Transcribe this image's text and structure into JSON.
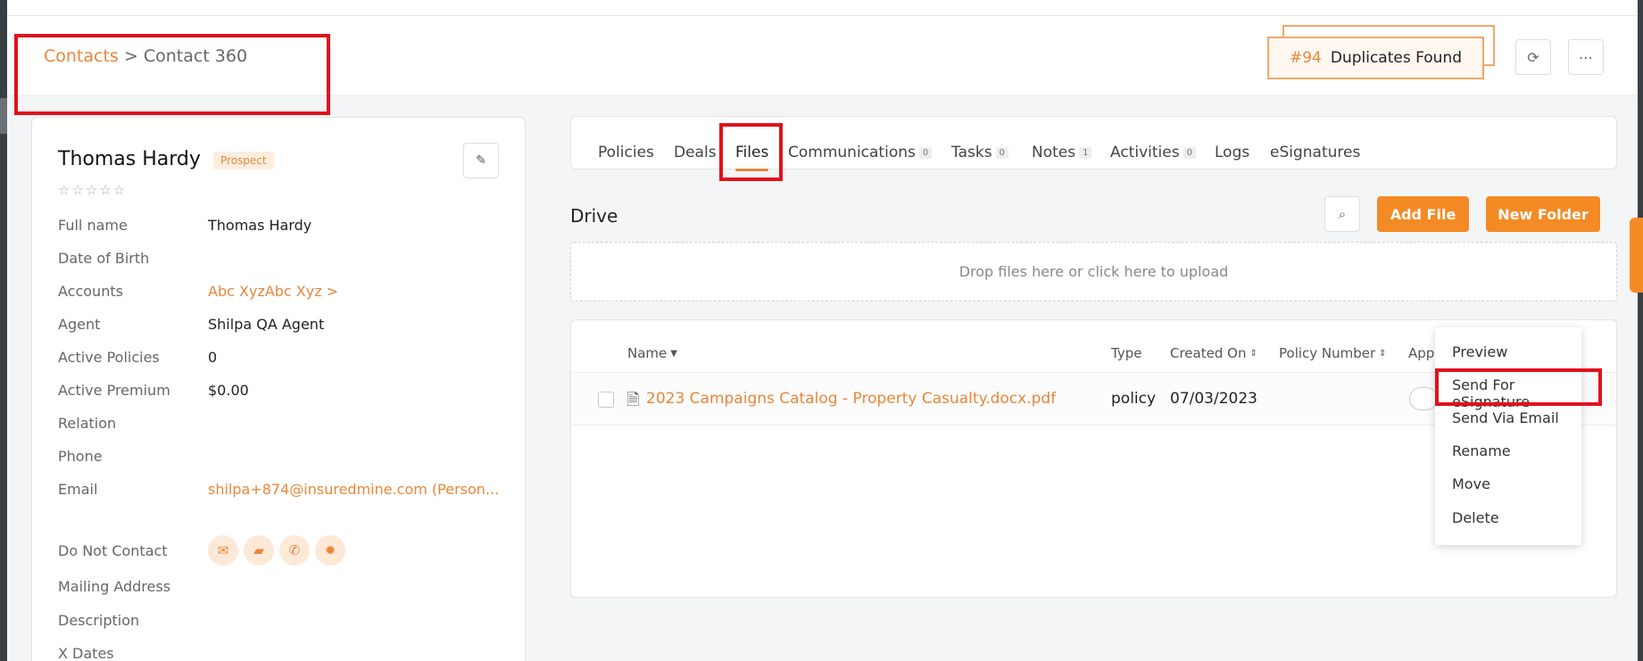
{
  "breadcrumb": {
    "root": "Contacts",
    "separator": ">",
    "current": "Contact 360"
  },
  "duplicates": {
    "count": "#94",
    "label": "Duplicates Found"
  },
  "header_icons": {
    "refresh": "refresh-icon",
    "more": "more-icon"
  },
  "contact": {
    "name": "Thomas Hardy",
    "status_badge": "Prospect",
    "rating_stars": "☆☆☆☆☆",
    "fields": [
      {
        "label": "Full name",
        "value": "Thomas Hardy"
      },
      {
        "label": "Date of Birth",
        "value": ""
      },
      {
        "label": "Accounts",
        "value": "Abc XyzAbc Xyz >"
      },
      {
        "label": "Agent",
        "value": "Shilpa QA Agent"
      },
      {
        "label": "Active Policies",
        "value": "0"
      },
      {
        "label": "Active Premium",
        "value": "$0.00"
      },
      {
        "label": "Relation",
        "value": ""
      },
      {
        "label": "Phone",
        "value": ""
      },
      {
        "label": "Email",
        "value": "shilpa+874@insuredmine.com  (Person..."
      },
      {
        "label": "Do Not Contact",
        "value": ""
      },
      {
        "label": "Mailing Address",
        "value": ""
      },
      {
        "label": "Description",
        "value": ""
      },
      {
        "label": "X Dates",
        "value": ""
      }
    ],
    "do_not_contact_icons": [
      "mail-icon",
      "chat-icon",
      "phone-icon",
      "sun-icon"
    ]
  },
  "tabs": [
    {
      "label": "Policies",
      "count": ""
    },
    {
      "label": "Deals",
      "count": ""
    },
    {
      "label": "Files",
      "count": ""
    },
    {
      "label": "Communications",
      "count": "0"
    },
    {
      "label": "Tasks",
      "count": "0"
    },
    {
      "label": "Notes",
      "count": "1"
    },
    {
      "label": "Activities",
      "count": "0"
    },
    {
      "label": "Logs",
      "count": ""
    },
    {
      "label": "eSignatures",
      "count": ""
    }
  ],
  "active_tab": "Files",
  "drive": {
    "title": "Drive",
    "add_file": "Add File",
    "new_folder": "New Folder",
    "dropzone": "Drop files here or click here to upload"
  },
  "table": {
    "columns": [
      "Name",
      "Type",
      "Created On",
      "Policy Number",
      "App"
    ],
    "rows": [
      {
        "name": "2023 Campaigns Catalog - Property Casualty.docx.pdf",
        "type": "policy",
        "created_on": "07/03/2023",
        "policy_number": ""
      }
    ]
  },
  "context_menu": [
    "Preview",
    "Send For eSignature",
    "Send Via Email",
    "Rename",
    "Move",
    "Delete"
  ],
  "colors": {
    "accent": "#f48a24",
    "link": "#e8863a",
    "highlight": "#e0121c"
  }
}
